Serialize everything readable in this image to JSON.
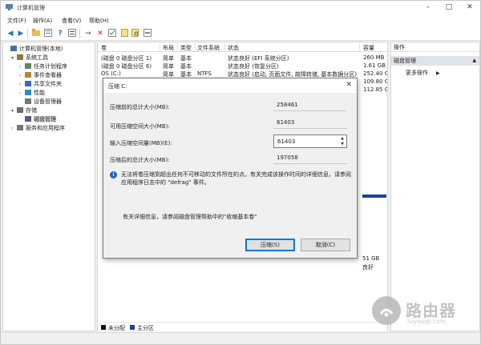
{
  "window": {
    "title": "计算机管理"
  },
  "menu": [
    "文件(F)",
    "操作(A)",
    "查看(V)",
    "帮助(H)"
  ],
  "tree": [
    {
      "label": "计算机管理(本地)",
      "indent": 0,
      "twisty": "",
      "selected": false
    },
    {
      "label": "系统工具",
      "indent": 1,
      "twisty": "▾",
      "selected": false
    },
    {
      "label": "任务计划程序",
      "indent": 2,
      "twisty": "›",
      "selected": false
    },
    {
      "label": "事件查看器",
      "indent": 2,
      "twisty": "›",
      "selected": false
    },
    {
      "label": "共享文件夹",
      "indent": 2,
      "twisty": "›",
      "selected": false
    },
    {
      "label": "性能",
      "indent": 2,
      "twisty": "›",
      "selected": false
    },
    {
      "label": "设备管理器",
      "indent": 2,
      "twisty": "",
      "selected": false
    },
    {
      "label": "存储",
      "indent": 1,
      "twisty": "▾",
      "selected": false
    },
    {
      "label": "磁盘管理",
      "indent": 2,
      "twisty": "",
      "selected": true
    },
    {
      "label": "服务和应用程序",
      "indent": 1,
      "twisty": "›",
      "selected": false
    }
  ],
  "grid": {
    "columns": [
      "卷",
      "布局",
      "类型",
      "文件系统",
      "状态",
      "容量"
    ],
    "rows": [
      [
        "(磁盘 0 磁盘分区 1)",
        "简单",
        "基本",
        "",
        "状态良好 (EFI 系统分区)",
        "260 MB"
      ],
      [
        "(磁盘 0 磁盘分区 6)",
        "简单",
        "基本",
        "",
        "状态良好 (恢复分区)",
        "1.61 GB"
      ],
      [
        "OS (C:)",
        "简单",
        "基本",
        "NTFS",
        "状态良好 (启动, 页面文件, 故障转储, 基本数据分区)",
        "252.40 GB"
      ],
      [
        "",
        "",
        "",
        "",
        "",
        "109.80 G"
      ],
      [
        "",
        "",
        "",
        "",
        "",
        "112.85 G"
      ]
    ]
  },
  "disk_strip": {
    "size": "51 GB",
    "status": "良好"
  },
  "legend": [
    "未分配",
    "主分区"
  ],
  "actions": {
    "header": "操作",
    "section": "磁盘管理",
    "more": "更多操作"
  },
  "dialog": {
    "title": "压缩 C:",
    "rows": [
      {
        "label": "压缩前的总计大小(MB):",
        "value": "258461"
      },
      {
        "label": "可用压缩空间大小(MB):",
        "value": "61403"
      },
      {
        "label": "输入压缩空间量(MB)(E):",
        "value": "61403"
      },
      {
        "label": "压缩后的总计大小(MB):",
        "value": "197058"
      }
    ],
    "info": "无法将卷压缩到超出任何不可移动的文件所在的点。有关完成该操作时间的详细信息，请参阅应用程序日志中的 \"defrag\" 事件。",
    "help": "有关详细信息，请参阅磁盘管理帮助中的\"收缩基本卷\"",
    "ok": "压缩(S)",
    "cancel": "取消(C)"
  },
  "watermark": {
    "text": "路由器",
    "sub": "luyouqi.com"
  },
  "colors": {
    "accent": "#0078d7",
    "primary_partition": "#1f3f99",
    "selection": "#dfe3ea"
  },
  "icons": [
    "back-arrow-icon",
    "forward-arrow-icon",
    "folder-icon",
    "properties-icon",
    "help-icon",
    "connect-icon",
    "delete-icon",
    "doc-icon",
    "search-icon",
    "more-icon"
  ]
}
